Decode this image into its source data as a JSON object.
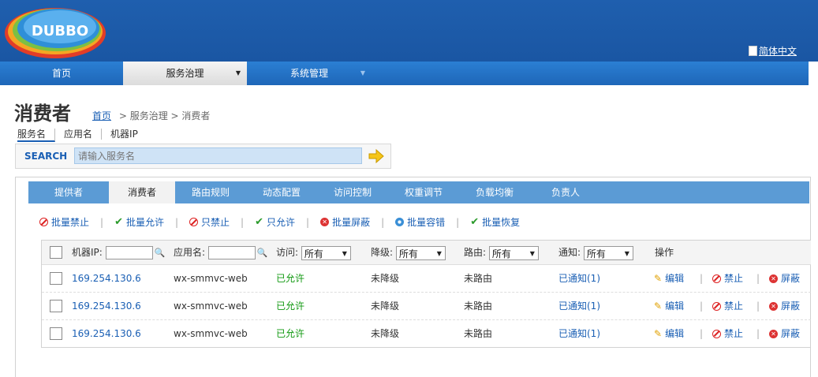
{
  "header": {
    "logo_text": "DUBBO",
    "language": "简体中文"
  },
  "nav": {
    "items": [
      {
        "label": "首页"
      },
      {
        "label": "服务治理",
        "arrow": "▼"
      },
      {
        "label": "系统管理",
        "arrow": "▼"
      }
    ]
  },
  "page": {
    "title": "消费者",
    "breadcrumb": {
      "home": "首页",
      "level2": "> 服务治理",
      "level3": "> 消费者"
    },
    "search_tabs": [
      "服务名",
      "应用名",
      "机器IP"
    ],
    "search": {
      "label": "SEARCH",
      "placeholder": "请输入服务名"
    }
  },
  "panel": {
    "tabs": [
      "提供者",
      "消费者",
      "路由规则",
      "动态配置",
      "访问控制",
      "权重调节",
      "负载均衡",
      "负责人"
    ],
    "actions": [
      {
        "label": "批量禁止",
        "icon": "ban-icon"
      },
      {
        "label": "批量允许",
        "icon": "check-icon"
      },
      {
        "label": "只禁止",
        "icon": "ban-icon"
      },
      {
        "label": "只允许",
        "icon": "check-icon"
      },
      {
        "label": "批量屏蔽",
        "icon": "x-circle-icon"
      },
      {
        "label": "批量容错",
        "icon": "gear-icon"
      },
      {
        "label": "批量恢复",
        "icon": "check-icon"
      }
    ]
  },
  "table": {
    "headers": {
      "ip": "机器IP:",
      "app": "应用名:",
      "access": "访问:",
      "degrade": "降级:",
      "route": "路由:",
      "notify": "通知:",
      "ops": "操作"
    },
    "filter_value": "所有",
    "rows": [
      {
        "ip": "169.254.130.6",
        "app": "wx-smmvc-web",
        "access": "已允许",
        "degrade": "未降级",
        "route": "未路由",
        "notify": "已通知(1)"
      },
      {
        "ip": "169.254.130.6",
        "app": "wx-smmvc-web",
        "access": "已允许",
        "degrade": "未降级",
        "route": "未路由",
        "notify": "已通知(1)"
      },
      {
        "ip": "169.254.130.6",
        "app": "wx-smmvc-web",
        "access": "已允许",
        "degrade": "未降级",
        "route": "未路由",
        "notify": "已通知(1)"
      }
    ],
    "row_ops": {
      "edit": "编辑",
      "forbid": "禁止",
      "shield": "屏蔽"
    }
  }
}
